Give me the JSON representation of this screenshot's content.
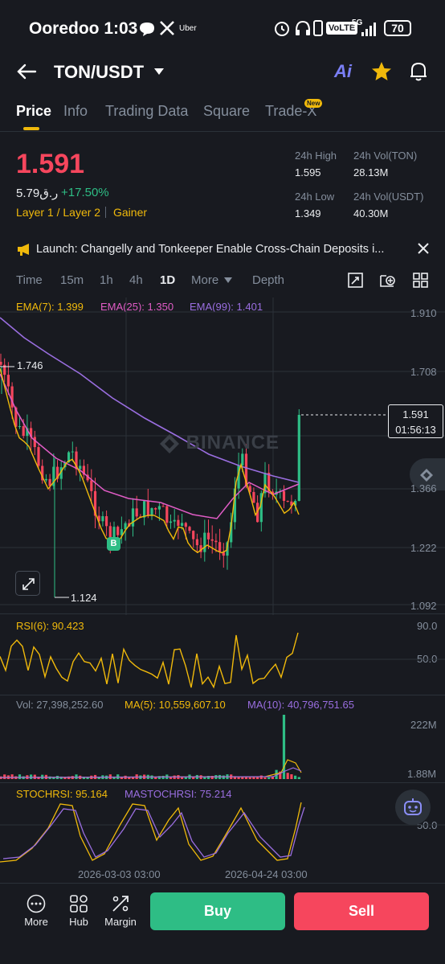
{
  "status_bar": {
    "carrier_time": "Ooredoo 1:03",
    "app_icons": [
      "chat-bubble-icon",
      "x-icon"
    ],
    "uber": "Uber",
    "volte": "VoLTE",
    "network": "5G",
    "battery": "70"
  },
  "header": {
    "pair": "TON/USDT",
    "ai_label": "Ai"
  },
  "tabs": [
    "Price",
    "Info",
    "Trading Data",
    "Square",
    "Trade-X"
  ],
  "new_badge": "New",
  "ticker": {
    "price": "1.591",
    "local_price": "5.79ر.ق",
    "change": "+17.50%",
    "tag1": "Layer 1 / Layer 2",
    "tag2": "Gainer",
    "high_label": "24h High",
    "high_value": "1.595",
    "vol_ton_label": "24h Vol(TON)",
    "vol_ton_value": "28.13M",
    "low_label": "24h Low",
    "low_value": "1.349",
    "vol_usdt_label": "24h Vol(USDT)",
    "vol_usdt_value": "40.30M"
  },
  "announcement": "Launch: Changelly and Tonkeeper Enable Cross-Chain Deposits i...",
  "timeframes": [
    "Time",
    "15m",
    "1h",
    "4h",
    "1D",
    "More",
    "Depth"
  ],
  "active_timeframe": "1D",
  "ema": {
    "ema7": "EMA(7): 1.399",
    "ema25": "EMA(25): 1.350",
    "ema99": "EMA(99): 1.401"
  },
  "price_axis": [
    "1.910",
    "1.708",
    "1.366",
    "1.222",
    "1.092"
  ],
  "watermark": "BINANCE",
  "chart_labels": {
    "high": "1.746",
    "low": "1.124",
    "current": "1.591",
    "countdown": "01:56:13",
    "buy_marker": "B"
  },
  "rsi": {
    "label": "RSI(6): 90.423",
    "axis_top": "90.0",
    "axis_mid": "50.0"
  },
  "volume": {
    "label": "Vol: 27,398,252.60",
    "ma5": "MA(5): 10,559,607.10",
    "ma10": "MA(10): 40,796,751.65",
    "axis_top": "222M",
    "axis_bottom": "1.88M"
  },
  "stoch": {
    "label": "STOCHRSI: 95.164",
    "mastoch": "MASTOCHRSI: 75.214",
    "axis_mid": "50.0"
  },
  "dates": [
    "2026-03-03 03:00",
    "2026-04-24 03:00"
  ],
  "bottom_nav": {
    "more": "More",
    "hub": "Hub",
    "margin": "Margin",
    "buy": "Buy",
    "sell": "Sell"
  },
  "colors": {
    "up": "#2ebd85",
    "down": "#f6465d",
    "accent": "#f0b90b",
    "ema7": "#f0b90b",
    "ema25": "#e05cc5",
    "ema99": "#9a6ee0"
  }
}
